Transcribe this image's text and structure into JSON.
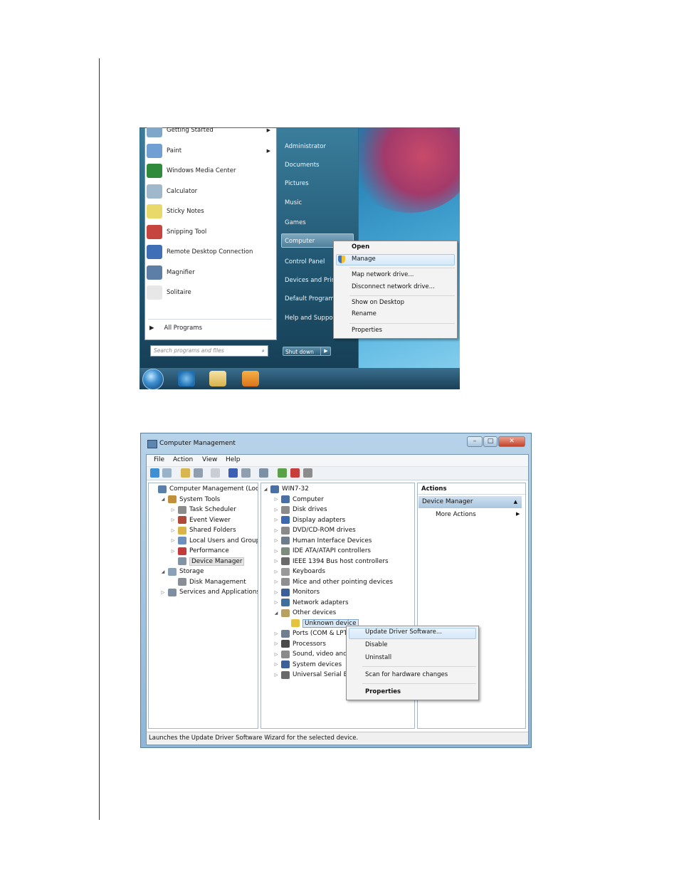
{
  "start_menu": {
    "programs": [
      {
        "label": "Getting Started",
        "has_arrow": true,
        "icon": "getting-started-icon",
        "color": "#7fa7c9"
      },
      {
        "label": "Paint",
        "has_arrow": true,
        "icon": "paint-icon",
        "color": "#6f9fd3"
      },
      {
        "label": "Windows Media Center",
        "has_arrow": false,
        "icon": "media-center-icon",
        "color": "#2f8a3b"
      },
      {
        "label": "Calculator",
        "has_arrow": false,
        "icon": "calculator-icon",
        "color": "#9fb8cc"
      },
      {
        "label": "Sticky Notes",
        "has_arrow": false,
        "icon": "sticky-notes-icon",
        "color": "#e9d86a"
      },
      {
        "label": "Snipping Tool",
        "has_arrow": false,
        "icon": "scissors-icon",
        "color": "#c7453f"
      },
      {
        "label": "Remote Desktop Connection",
        "has_arrow": false,
        "icon": "remote-desktop-icon",
        "color": "#3f6fb6"
      },
      {
        "label": "Magnifier",
        "has_arrow": false,
        "icon": "magnifier-icon",
        "color": "#5d7fa6"
      },
      {
        "label": "Solitaire",
        "has_arrow": false,
        "icon": "cards-icon",
        "color": "#e7e7e7"
      }
    ],
    "all_programs": "All Programs",
    "search_placeholder": "Search programs and files",
    "right_items": [
      "Administrator",
      "Documents",
      "Pictures",
      "Music",
      "Games",
      "Computer",
      "Control Panel",
      "Devices and Printers",
      "Default Programs",
      "Help and Support"
    ],
    "shut_down": "Shut down"
  },
  "computer_context_menu": {
    "items": [
      "Open",
      "Manage",
      "Map network drive...",
      "Disconnect network drive...",
      "Show on Desktop",
      "Rename",
      "Properties"
    ],
    "highlighted": "Manage"
  },
  "computer_management": {
    "title": "Computer Management",
    "menu": [
      "File",
      "Action",
      "View",
      "Help"
    ],
    "tree": [
      {
        "label": "Computer Management (Local",
        "level": 0,
        "toggle": "",
        "color": "#5a7fa8"
      },
      {
        "label": "System Tools",
        "level": 1,
        "toggle": "◢",
        "color": "#c0913a"
      },
      {
        "label": "Task Scheduler",
        "level": 2,
        "toggle": "▷",
        "color": "#8c8c8c"
      },
      {
        "label": "Event Viewer",
        "level": 2,
        "toggle": "▷",
        "color": "#b04a3a"
      },
      {
        "label": "Shared Folders",
        "level": 2,
        "toggle": "▷",
        "color": "#d9b448"
      },
      {
        "label": "Local Users and Groups",
        "level": 2,
        "toggle": "▷",
        "color": "#6b8fbf"
      },
      {
        "label": "Performance",
        "level": 2,
        "toggle": "▷",
        "color": "#c43a3a"
      },
      {
        "label": "Device Manager",
        "level": 2,
        "toggle": "",
        "color": "#8293a6",
        "selected": true
      },
      {
        "label": "Storage",
        "level": 1,
        "toggle": "◢",
        "color": "#8aa0b6"
      },
      {
        "label": "Disk Management",
        "level": 2,
        "toggle": "",
        "color": "#8a8f96"
      },
      {
        "label": "Services and Applications",
        "level": 1,
        "toggle": "▷",
        "color": "#7e8ea3"
      }
    ],
    "devices_root": "WIN7-32",
    "devices": [
      {
        "label": "Computer",
        "color": "#4a6fa5"
      },
      {
        "label": "Disk drives",
        "color": "#8c8c8c"
      },
      {
        "label": "Display adapters",
        "color": "#3c6ab0"
      },
      {
        "label": "DVD/CD-ROM drives",
        "color": "#8a8a8a"
      },
      {
        "label": "Human Interface Devices",
        "color": "#6d7d8e"
      },
      {
        "label": "IDE ATA/ATAPI controllers",
        "color": "#7d8d7d"
      },
      {
        "label": "IEEE 1394 Bus host controllers",
        "color": "#6a6a6a"
      },
      {
        "label": "Keyboards",
        "color": "#9a9a9a"
      },
      {
        "label": "Mice and other pointing devices",
        "color": "#8f8f8f"
      },
      {
        "label": "Monitors",
        "color": "#3a5f9a"
      },
      {
        "label": "Network adapters",
        "color": "#3f6f9f"
      },
      {
        "label": "Other devices",
        "color": "#b8a060",
        "expanded": true
      },
      {
        "label": "Unknown device",
        "color": "#e3c43c",
        "child": true,
        "selected": true
      },
      {
        "label": "Ports (COM & LPT)",
        "color": "#6f7f8f"
      },
      {
        "label": "Processors",
        "color": "#4a4a4a"
      },
      {
        "label": "Sound, video and game controllers",
        "color": "#8a8a8a"
      },
      {
        "label": "System devices",
        "color": "#3c5f9a"
      },
      {
        "label": "Universal Serial Bus controllers",
        "color": "#6a6a6a"
      }
    ],
    "actions_header": "Actions",
    "actions_selected": "Device Manager",
    "more_actions": "More Actions",
    "status": "Launches the Update Driver Software Wizard for the selected device."
  },
  "device_context_menu": {
    "items": [
      "Update Driver Software...",
      "Disable",
      "Uninstall",
      "Scan for hardware changes",
      "Properties"
    ],
    "highlighted": "Update Driver Software..."
  }
}
